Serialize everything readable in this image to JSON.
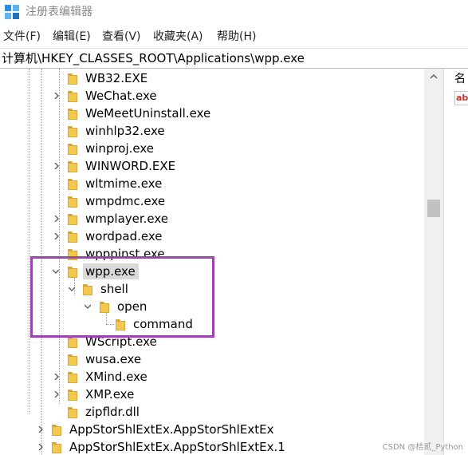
{
  "window": {
    "title": "注册表编辑器"
  },
  "menu": {
    "items": [
      "文件(F)",
      "编辑(E)",
      "查看(V)",
      "收藏夹(A)",
      "帮助(H)"
    ]
  },
  "address": {
    "path": "计算机\\HKEY_CLASSES_ROOT\\Applications\\wpp.exe"
  },
  "tree": {
    "nodes": [
      {
        "label": "WB32.EXE",
        "expandable": false
      },
      {
        "label": "WeChat.exe",
        "expandable": true
      },
      {
        "label": "WeMeetUninstall.exe",
        "expandable": false
      },
      {
        "label": "winhlp32.exe",
        "expandable": false
      },
      {
        "label": "winproj.exe",
        "expandable": false
      },
      {
        "label": "WINWORD.EXE",
        "expandable": true
      },
      {
        "label": "wltmime.exe",
        "expandable": false
      },
      {
        "label": "wmpdmc.exe",
        "expandable": false
      },
      {
        "label": "wmplayer.exe",
        "expandable": true
      },
      {
        "label": "wordpad.exe",
        "expandable": true
      },
      {
        "label": "wpppinst.exe",
        "expandable": false
      },
      {
        "label": "wpp.exe",
        "expandable": true,
        "expanded": true,
        "selected": true
      },
      {
        "label": "shell",
        "expandable": true,
        "expanded": true
      },
      {
        "label": "open",
        "expandable": true,
        "expanded": true
      },
      {
        "label": "command",
        "expandable": false
      },
      {
        "label": "WScript.exe",
        "expandable": false
      },
      {
        "label": "wusa.exe",
        "expandable": false
      },
      {
        "label": "XMind.exe",
        "expandable": true
      },
      {
        "label": "XMP.exe",
        "expandable": true
      },
      {
        "label": "zipfldr.dll",
        "expandable": false
      },
      {
        "label": "AppStorShlExtEx.AppStorShlExtEx",
        "expandable": true
      },
      {
        "label": "AppStorShlExtEx.AppStorShlExtEx.1",
        "expandable": true
      }
    ]
  },
  "right_pane": {
    "column_header": "名"
  },
  "watermark": "CSDN @桔贰_Python",
  "colors": {
    "highlight_box": "#9b44ad",
    "selection": "#d9d9d9",
    "folder": "#f3c84e"
  }
}
